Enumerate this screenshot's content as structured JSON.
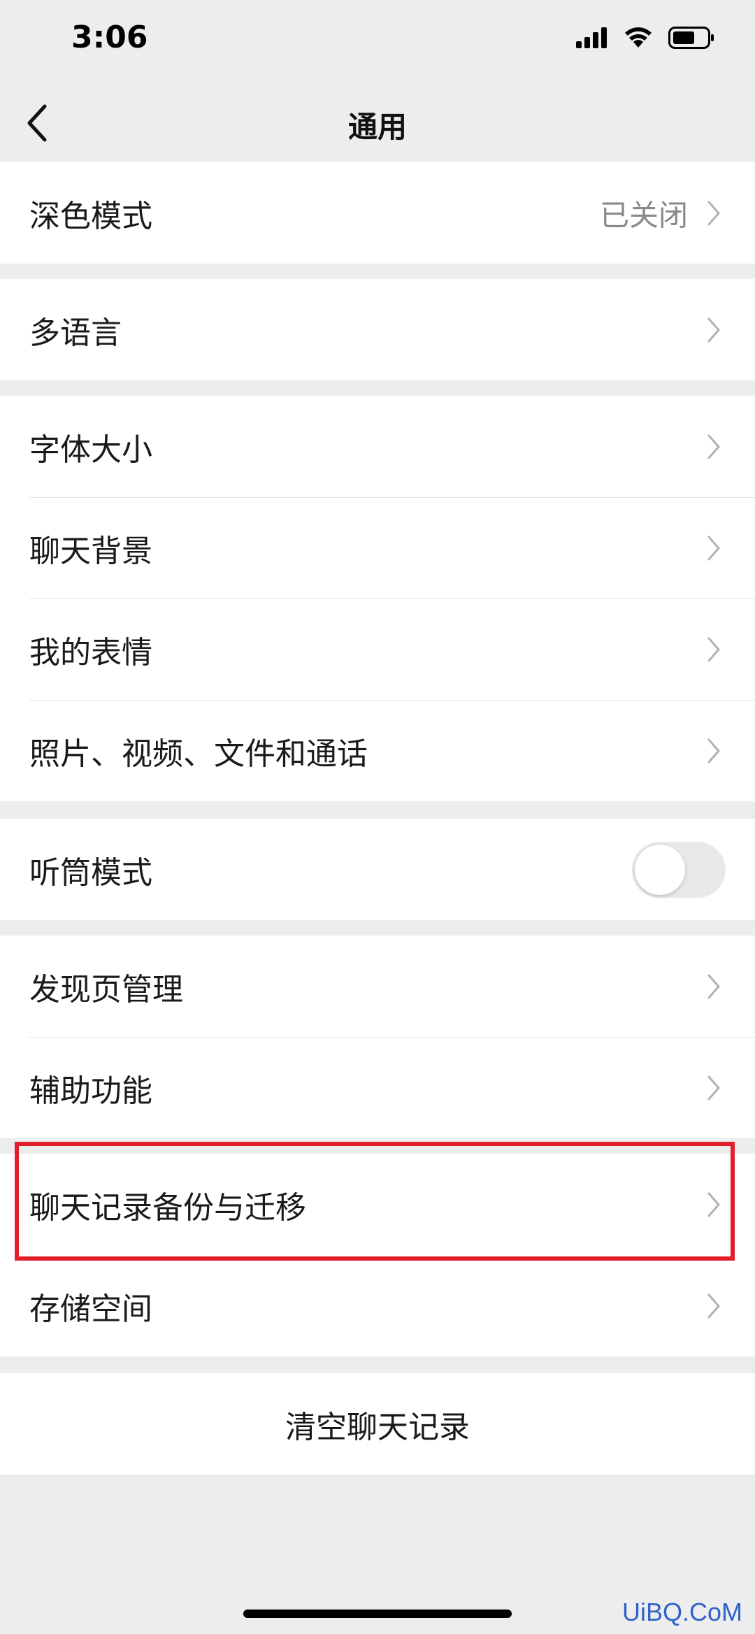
{
  "status_bar": {
    "time": "3:06",
    "icons": [
      "signal-icon",
      "wifi-icon",
      "battery-icon"
    ]
  },
  "nav": {
    "title": "通用",
    "back_icon": "chevron-left-icon"
  },
  "groups": [
    {
      "items": [
        {
          "label": "深色模式",
          "value": "已关闭"
        }
      ]
    },
    {
      "items": [
        {
          "label": "多语言"
        }
      ]
    },
    {
      "items": [
        {
          "label": "字体大小"
        },
        {
          "label": "聊天背景"
        },
        {
          "label": "我的表情"
        },
        {
          "label": "照片、视频、文件和通话"
        }
      ]
    },
    {
      "items": [
        {
          "label": "听筒模式",
          "toggle": false
        }
      ]
    },
    {
      "items": [
        {
          "label": "发现页管理"
        },
        {
          "label": "辅助功能"
        }
      ]
    },
    {
      "items": [
        {
          "label": "聊天记录备份与迁移",
          "highlighted": true
        },
        {
          "label": "存储空间"
        }
      ]
    }
  ],
  "clear_button": {
    "label": "清空聊天记录"
  },
  "watermark": "UiBQ.CoM",
  "colors": {
    "background": "#ededed",
    "highlight": "#e01f2a",
    "secondary_text": "#8a8a8a"
  }
}
